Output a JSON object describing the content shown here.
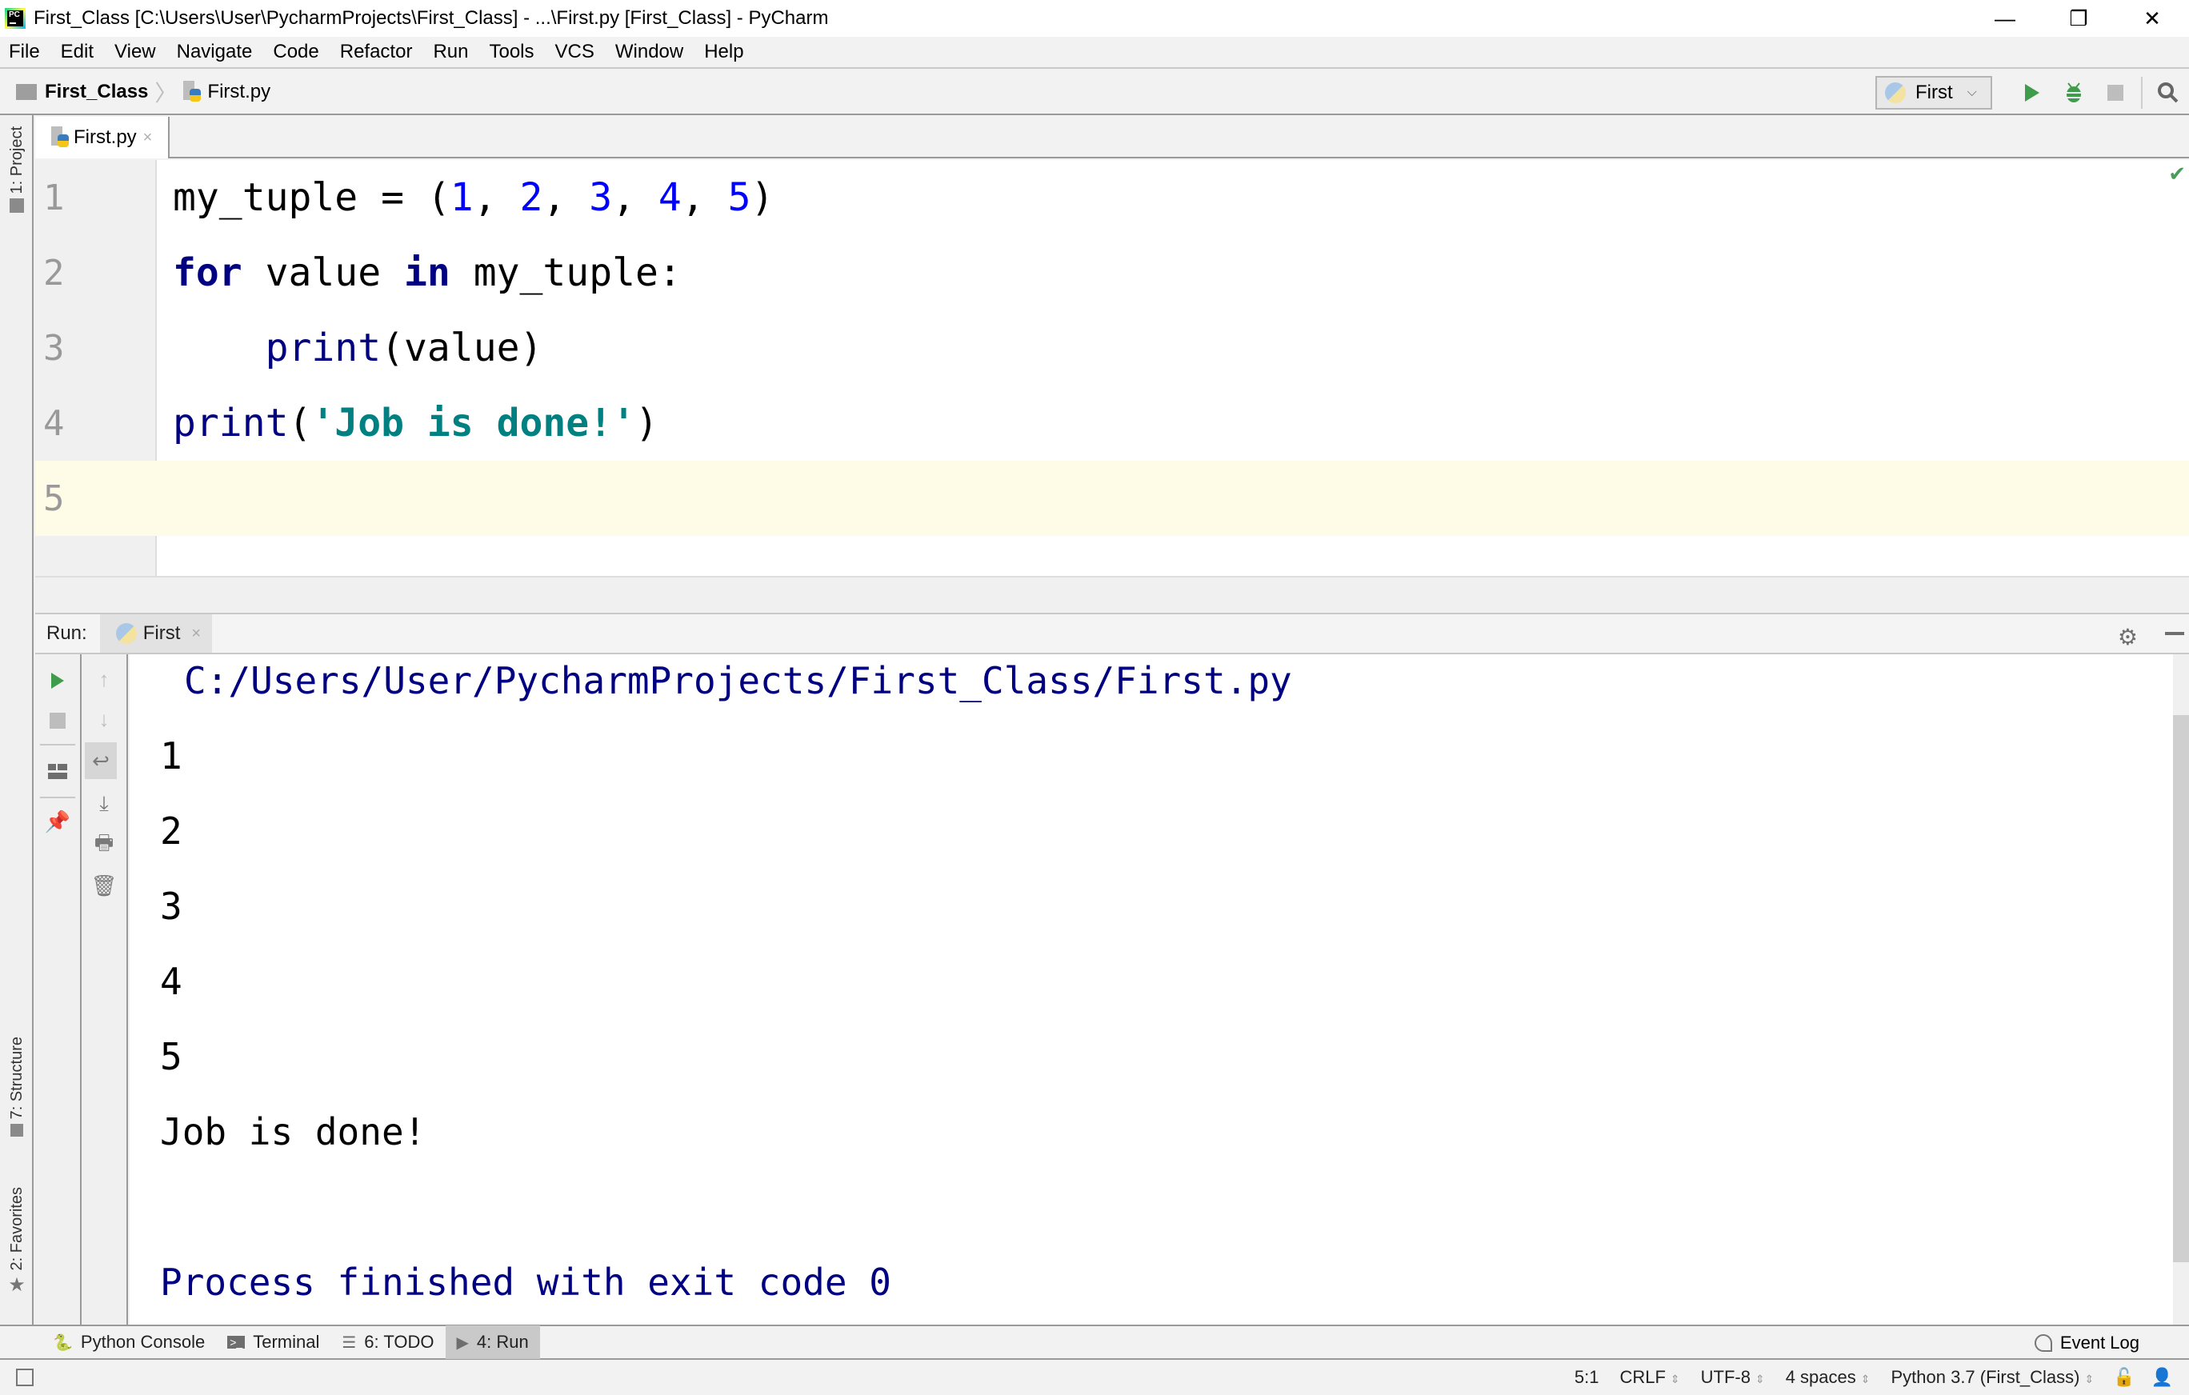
{
  "window": {
    "title": "First_Class [C:\\Users\\User\\PycharmProjects\\First_Class] - ...\\First.py [First_Class] - PyCharm",
    "logo_text": "PC",
    "minimize": "—",
    "restore": "❐",
    "close": "✕"
  },
  "menu": [
    "File",
    "Edit",
    "View",
    "Navigate",
    "Code",
    "Refactor",
    "Run",
    "Tools",
    "VCS",
    "Window",
    "Help"
  ],
  "breadcrumb": {
    "project": "First_Class",
    "separator": "〉",
    "file": "First.py"
  },
  "toolbar": {
    "run_config": "First",
    "run_config_chevron": "⌵"
  },
  "left_tool_windows": {
    "project": "1: Project",
    "structure": "7: Structure",
    "favorites": "2: Favorites"
  },
  "editor": {
    "tab": {
      "label": "First.py",
      "close": "×"
    },
    "current_line": 5,
    "inspection_status": "✔",
    "lines": [
      {
        "num": "1"
      },
      {
        "num": "2"
      },
      {
        "num": "3"
      },
      {
        "num": "4"
      },
      {
        "num": "5"
      }
    ],
    "code": {
      "l1_name": "my_tuple = (",
      "l1_n1": "1",
      "l1_c1": ", ",
      "l1_n2": "2",
      "l1_c2": ", ",
      "l1_n3": "3",
      "l1_c3": ", ",
      "l1_n4": "4",
      "l1_c4": ", ",
      "l1_n5": "5",
      "l1_end": ")",
      "l2_for": "for",
      "l2_mid": " value ",
      "l2_in": "in",
      "l2_end": " my_tuple:",
      "l3_indent": "    ",
      "l3_print": "print",
      "l3_args": "(value)",
      "l4_print": "print",
      "l4_open": "(",
      "l4_str": "'Job is done!'",
      "l4_close": ")"
    },
    "colors": {
      "keyword": "#000080",
      "number": "#0000ff",
      "string": "#008080",
      "current_line_bg": "#fefbe6"
    }
  },
  "run_panel": {
    "label": "Run:",
    "tab": "First",
    "tab_close": "×",
    "console": {
      "command": "C:/Users/User/PycharmProjects/First_Class/First.py",
      "output": [
        "1",
        "2",
        "3",
        "4",
        "5",
        "Job is done!"
      ],
      "exit_message": "Process finished with exit code 0"
    }
  },
  "bottom_tools": [
    {
      "label": "Python Console",
      "icon": "python-icon"
    },
    {
      "label": "Terminal",
      "icon": "terminal-icon"
    },
    {
      "label": "6: TODO",
      "icon": "list-icon"
    },
    {
      "label": "4: Run",
      "icon": "run-icon",
      "active": true
    }
  ],
  "event_log": "Event Log",
  "status": {
    "position": "5:1",
    "line_separator": "CRLF",
    "encoding": "UTF-8",
    "indent": "4 spaces",
    "interpreter": "Python 3.7 (First_Class)",
    "arrows": "⇕"
  }
}
